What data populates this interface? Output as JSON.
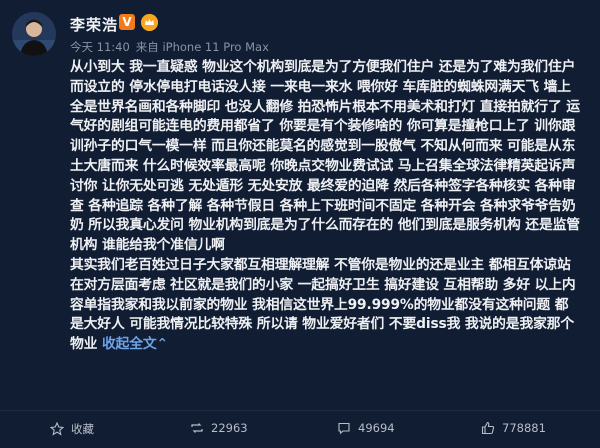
{
  "post": {
    "username": "李荣浩",
    "vip_label": "V",
    "time": "今天 11:40",
    "source": "来自 iPhone 11 Pro Max",
    "body_text": "从小到大 我一直疑惑 物业这个机构到底是为了方便我们住户 还是为了难为我们住户而设立的 停水停电打电话没人接 一来电一来水 喂你好 车库脏的蜘蛛网满天飞 墙上全是世界名画和各种脚印 也没人翻修 拍恐怖片根本不用美术和打灯 直接拍就行了 运气好的剧组可能连电的费用都省了 你要是有个装修啥的 你可算是撞枪口上了 训你跟训孙子的口气一模一样 而且你还能莫名的感觉到一股傲气 不知从何而来 可能是从东土大唐而来 什么时候效率最高呢 你晚点交物业费试试 马上召集全球法律精英起诉声讨你 让你无处可逃 无处遁形 无处安放 最终爱的迫降 然后各种签字各种核实 各种审查 各种追踪 各种了解 各种节假日 各种上下班时间不固定 各种开会 各种求爷爷告奶奶 所以我真心发问 物业机构到底是为了什么而存在的 他们到底是服务机构 还是监管机构 谁能给我个准信儿啊",
    "body_text_2": "其实我们老百姓过日子大家都互相理解理解 不管你是物业的还是业主 都相互体谅站在对方层面考虑 社区就是我们的小家 一起搞好卫生 搞好建设 互相帮助 多好 以上内容单指我家和我以前家的物业 我相信这世界上99.999%的物业都没有这种问题 都是大好人 可能我情况比较特殊 所以请 物业爱好者们 不要diss我 我说的是我家那个物业",
    "expand_label": "收起全文",
    "expand_arrow": "⌃"
  },
  "actions": {
    "favorite_label": "收藏",
    "repost_count": "22963",
    "comment_count": "49694",
    "like_count": "778881"
  },
  "colors": {
    "background": "#101d33",
    "link": "#6ea3e6",
    "vip_badge": "#f07a1c"
  }
}
